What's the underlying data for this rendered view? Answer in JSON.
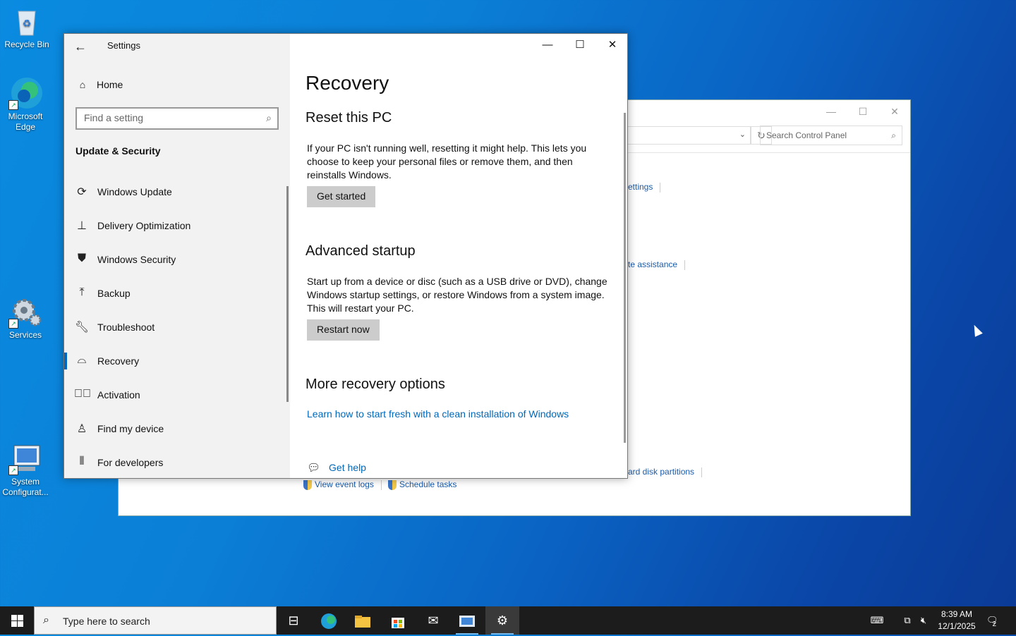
{
  "desktop": {
    "icons": [
      {
        "label": "Recycle Bin",
        "icon": "recycle-bin-icon"
      },
      {
        "label": "Microsoft Edge",
        "icon": "edge-icon"
      },
      {
        "label": "Services",
        "icon": "services-gear-icon"
      },
      {
        "label": "System Configurat...",
        "icon": "system-config-icon"
      }
    ]
  },
  "control_panel": {
    "search_placeholder": "Search Control Panel",
    "links": [
      "ettings",
      "te assistance",
      "ard disk partitions",
      "View event logs",
      "Schedule tasks"
    ]
  },
  "settings": {
    "app_title": "Settings",
    "home_label": "Home",
    "search_placeholder": "Find a setting",
    "section_heading": "Update & Security",
    "nav_items": [
      {
        "label": "Windows Update",
        "icon": "sync-icon"
      },
      {
        "label": "Delivery Optimization",
        "icon": "delivery-optimization-icon"
      },
      {
        "label": "Windows Security",
        "icon": "shield-icon"
      },
      {
        "label": "Backup",
        "icon": "backup-arrow-icon"
      },
      {
        "label": "Troubleshoot",
        "icon": "wrench-icon"
      },
      {
        "label": "Recovery",
        "icon": "recovery-icon",
        "selected": true
      },
      {
        "label": "Activation",
        "icon": "check-circle-icon"
      },
      {
        "label": "Find my device",
        "icon": "person-location-icon"
      },
      {
        "label": "For developers",
        "icon": "developer-tools-icon"
      }
    ],
    "page_title": "Recovery",
    "reset": {
      "heading": "Reset this PC",
      "description": "If your PC isn't running well, resetting it might help. This lets you choose to keep your personal files or remove them, and then reinstalls Windows.",
      "button": "Get started"
    },
    "advanced": {
      "heading": "Advanced startup",
      "description": "Start up from a device or disc (such as a USB drive or DVD), change Windows startup settings, or restore Windows from a system image. This will restart your PC.",
      "button": "Restart now"
    },
    "more": {
      "heading": "More recovery options",
      "link": "Learn how to start fresh with a clean installation of Windows"
    },
    "help_link": "Get help"
  },
  "taskbar": {
    "search_placeholder": "Type here to search",
    "time": "8:39 AM",
    "date": "12/1/2025",
    "notification_count": "2"
  },
  "colors": {
    "accent": "#0067c0",
    "link": "#0067b8"
  }
}
